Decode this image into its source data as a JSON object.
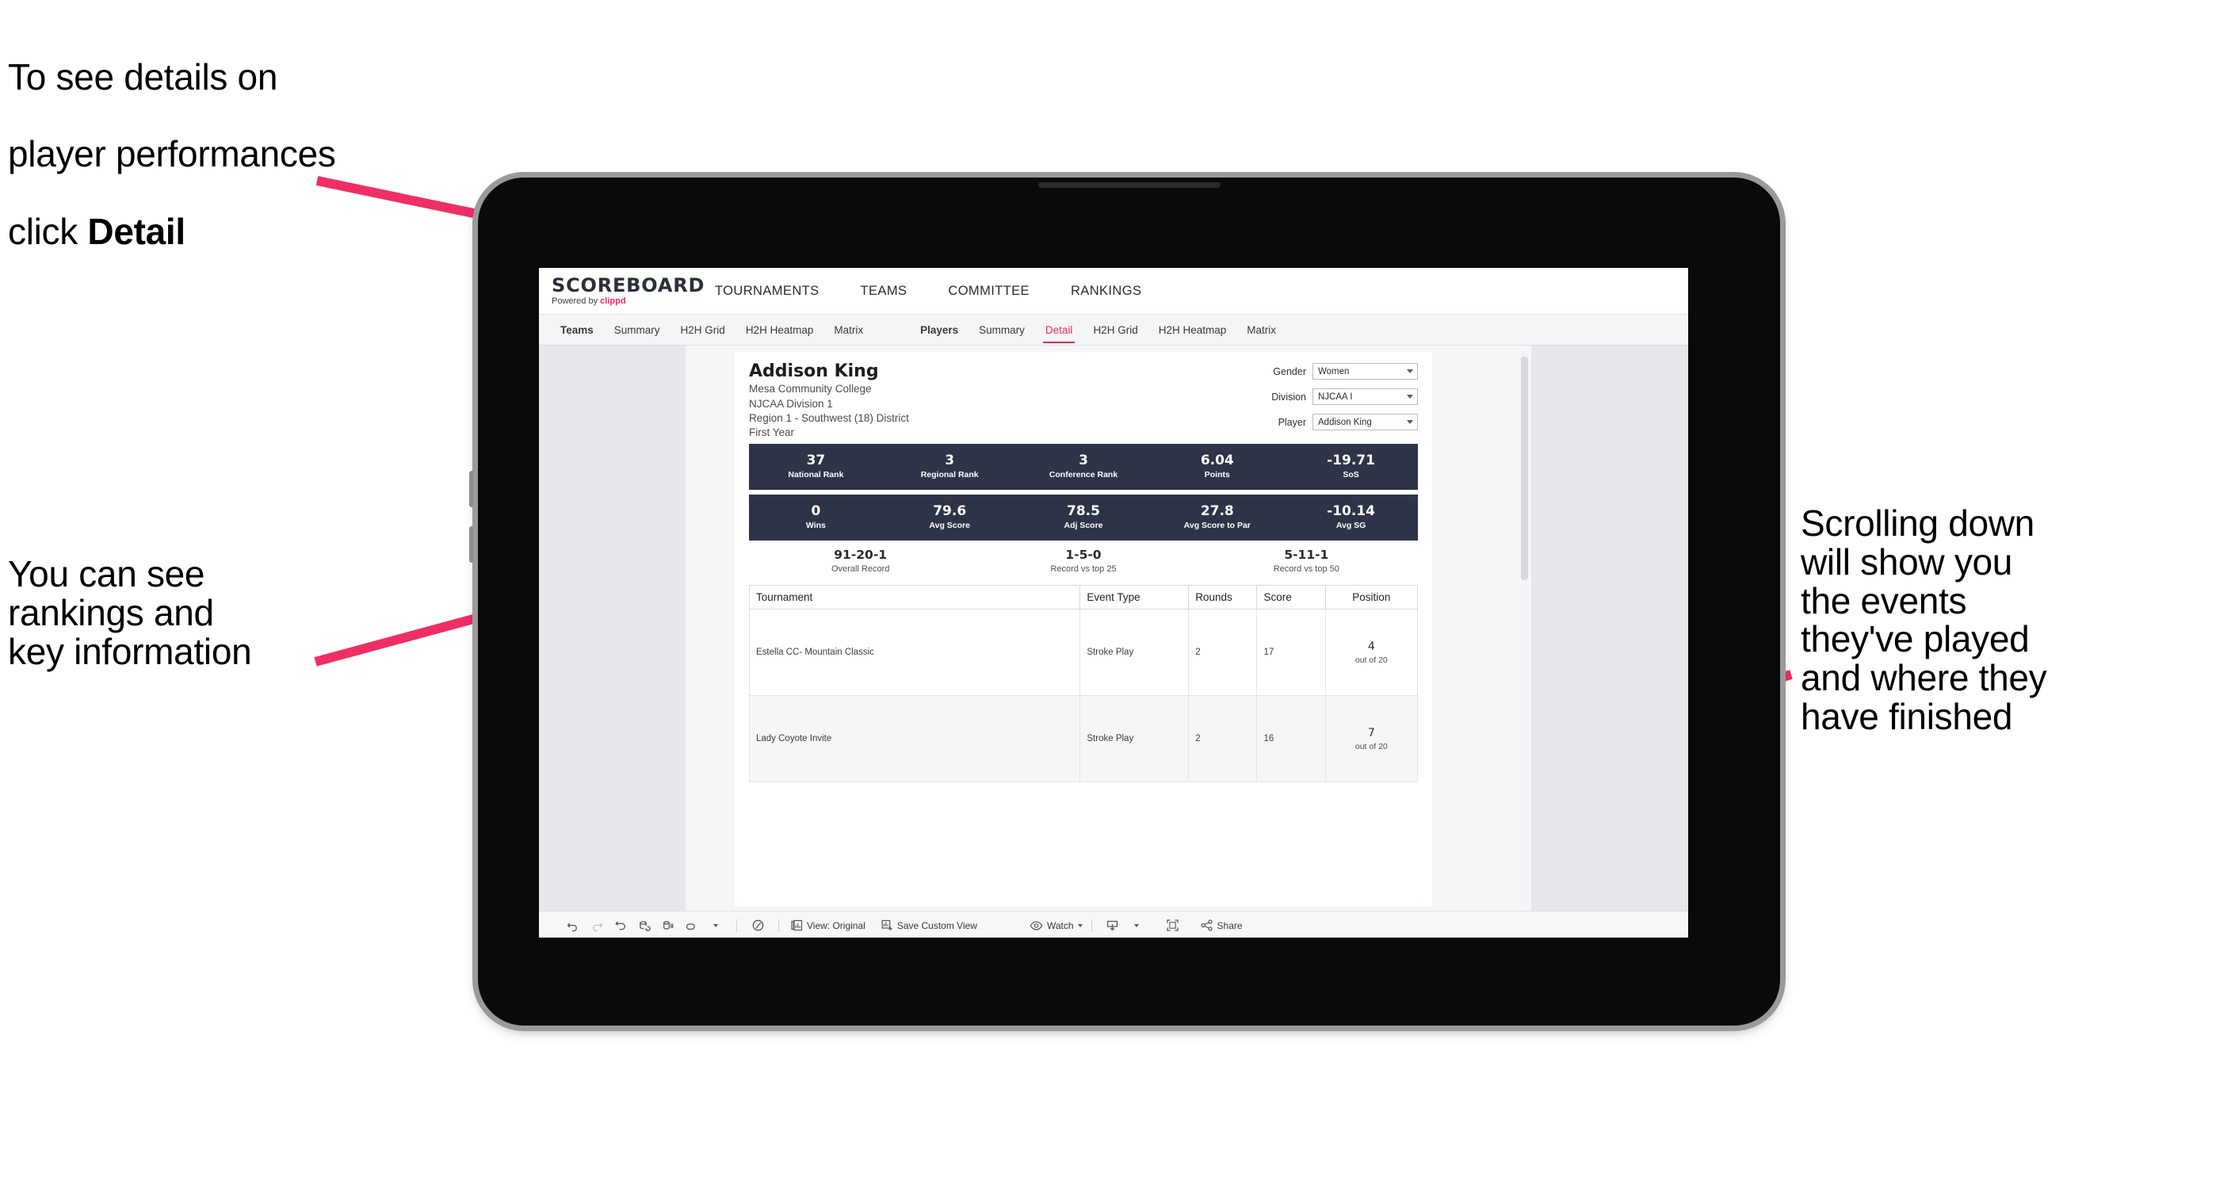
{
  "annotations": {
    "top_left_line1": "To see details on",
    "top_left_line2": "player performances",
    "top_left_line3_prefix": "click ",
    "top_left_line3_bold": "Detail",
    "mid_left": "You can see\nrankings and\nkey information",
    "right": "Scrolling down\nwill show you\nthe events\nthey've played\nand where they\nhave finished",
    "arrow_color": "#ef2f63"
  },
  "app": {
    "logo": {
      "main": "SCOREBOARD",
      "powered_prefix": "Powered by ",
      "brand": "clippd"
    },
    "top_nav": [
      "TOURNAMENTS",
      "TEAMS",
      "COMMITTEE",
      "RANKINGS"
    ],
    "tab_group_teams": [
      {
        "label": "Teams",
        "head": true,
        "active": false
      },
      {
        "label": "Summary",
        "head": false,
        "active": false
      },
      {
        "label": "H2H Grid",
        "head": false,
        "active": false
      },
      {
        "label": "H2H Heatmap",
        "head": false,
        "active": false
      },
      {
        "label": "Matrix",
        "head": false,
        "active": false
      }
    ],
    "tab_group_players": [
      {
        "label": "Players",
        "head": true,
        "active": false
      },
      {
        "label": "Summary",
        "head": false,
        "active": false
      },
      {
        "label": "Detail",
        "head": false,
        "active": true
      },
      {
        "label": "H2H Grid",
        "head": false,
        "active": false
      },
      {
        "label": "H2H Heatmap",
        "head": false,
        "active": false
      },
      {
        "label": "Matrix",
        "head": false,
        "active": false
      }
    ],
    "accent_color": "#e8295c",
    "statbar_color": "#2e3447"
  },
  "player": {
    "name": "Addison King",
    "school": "Mesa Community College",
    "division": "NJCAA Division 1",
    "region": "Region 1 - Southwest (18) District",
    "year": "First Year"
  },
  "filters": [
    {
      "label": "Gender",
      "value": "Women"
    },
    {
      "label": "Division",
      "value": "NJCAA I"
    },
    {
      "label": "Player",
      "value": "Addison King"
    }
  ],
  "stats_row_1": [
    {
      "value": "37",
      "label": "National Rank"
    },
    {
      "value": "3",
      "label": "Regional Rank"
    },
    {
      "value": "3",
      "label": "Conference Rank"
    },
    {
      "value": "6.04",
      "label": "Points"
    },
    {
      "value": "-19.71",
      "label": "SoS"
    }
  ],
  "stats_row_2": [
    {
      "value": "0",
      "label": "Wins"
    },
    {
      "value": "79.6",
      "label": "Avg Score"
    },
    {
      "value": "78.5",
      "label": "Adj Score"
    },
    {
      "value": "27.8",
      "label": "Avg Score to Par"
    },
    {
      "value": "-10.14",
      "label": "Avg SG"
    }
  ],
  "records": [
    {
      "value": "91-20-1",
      "label": "Overall Record"
    },
    {
      "value": "1-5-0",
      "label": "Record vs top 25"
    },
    {
      "value": "5-11-1",
      "label": "Record vs top 50"
    }
  ],
  "tournament_table": {
    "headers": [
      "Tournament",
      "Event Type",
      "Rounds",
      "Score",
      "Position"
    ],
    "rows": [
      {
        "tournament": "Estella CC- Mountain Classic",
        "event_type": "Stroke Play",
        "rounds": "2",
        "score": "17",
        "position": "4",
        "position_out_of": "out of 20"
      },
      {
        "tournament": "Lady Coyote Invite",
        "event_type": "Stroke Play",
        "rounds": "2",
        "score": "16",
        "position": "7",
        "position_out_of": "out of 20"
      }
    ]
  },
  "toolbar": {
    "view_label": "View: Original",
    "save_custom_view_label": "Save Custom View",
    "watch_label": "Watch",
    "share_label": "Share"
  }
}
